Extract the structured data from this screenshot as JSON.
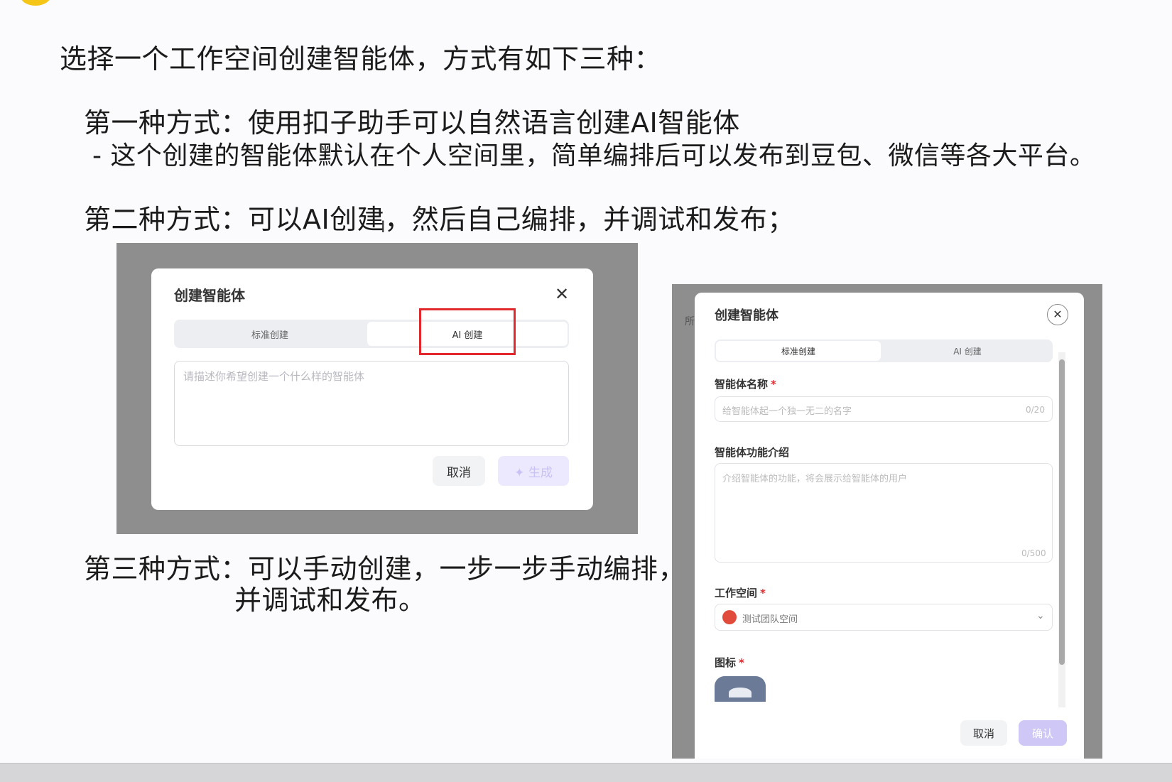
{
  "slide": {
    "intro": "选择一个工作空间创建智能体，方式有如下三种：",
    "method1_title": "第一种方式：使用扣子助手可以自然语言创建AI智能体",
    "method1_detail": "- 这个创建的智能体默认在个人空间里，简单编排后可以发布到豆包、微信等各大平台。",
    "method2_part1": "第二种方式：可以AI创建",
    "method2_part2": "，然后自己编排，并调试和发布；",
    "method3_line1": "第三种方式：可以手动创建，一步一步手动编排，",
    "method3_line2": "并调试和发布。"
  },
  "dialog_ai": {
    "title": "创建智能体",
    "tab_standard": "标准创建",
    "tab_ai": "AI 创建",
    "placeholder": "请描述你希望创建一个什么样的智能体",
    "cancel": "取消",
    "generate": "✦ 生成"
  },
  "dialog_manual": {
    "title": "创建智能体",
    "tab_standard": "标准创建",
    "tab_ai": "AI 创建",
    "name_label": "智能体名称",
    "name_placeholder": "给智能体起一个独一无二的名字",
    "name_counter": "0/20",
    "desc_label": "智能体功能介绍",
    "desc_placeholder": "介绍智能体的功能，将会展示给智能体的用户",
    "desc_counter": "0/500",
    "workspace_label": "工作空间",
    "workspace_value": "测试团队空间",
    "icon_label": "图标",
    "cancel": "取消",
    "confirm": "确认",
    "required_mark": "*"
  },
  "colors": {
    "highlight": "#e0282d",
    "accent_disabled": "#cfc8f7",
    "overlay": "#8e8e8f"
  }
}
